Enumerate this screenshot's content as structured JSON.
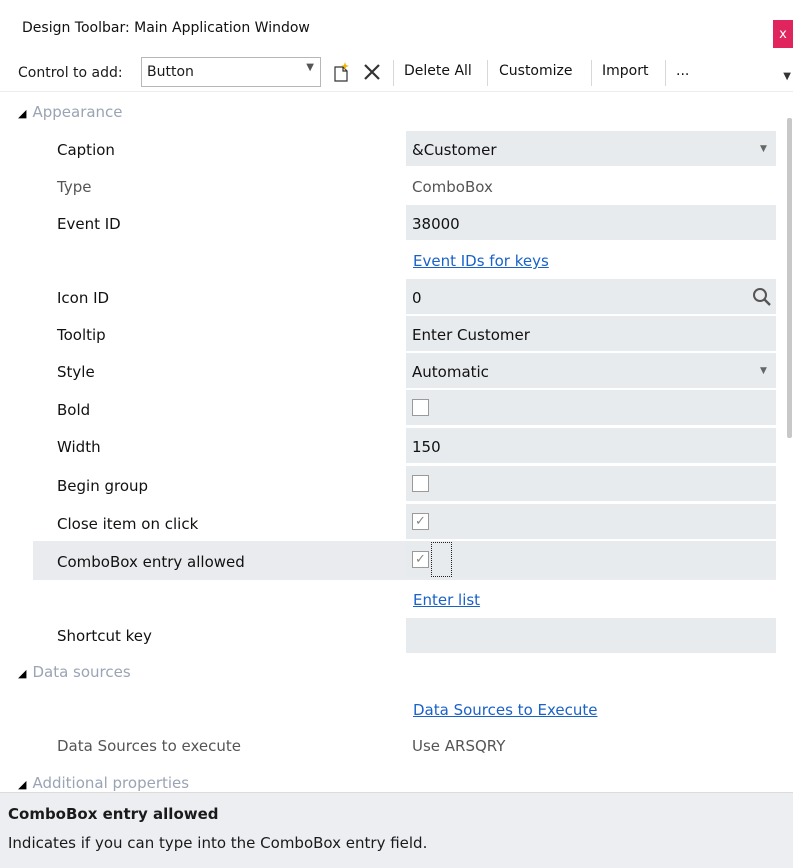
{
  "window": {
    "title": "Design Toolbar: Main Application Window",
    "close_label": "x"
  },
  "toolbar": {
    "control_label": "Control to add:",
    "control_value": "Button",
    "delete_all": "Delete All",
    "customize": "Customize",
    "import": "Import",
    "more": "..."
  },
  "sections": {
    "appearance": "Appearance",
    "data_sources": "Data sources",
    "additional": "Additional properties"
  },
  "properties": {
    "caption": {
      "label": "Caption",
      "value": "&Customer"
    },
    "type": {
      "label": "Type",
      "value": "ComboBox"
    },
    "event_id": {
      "label": "Event ID",
      "value": "38000"
    },
    "event_link": "Event IDs for keys",
    "icon_id": {
      "label": "Icon ID",
      "value": "0"
    },
    "tooltip": {
      "label": "Tooltip",
      "value": "Enter Customer"
    },
    "style": {
      "label": "Style",
      "value": "Automatic"
    },
    "bold": {
      "label": "Bold",
      "checked": false
    },
    "width": {
      "label": "Width",
      "value": "150"
    },
    "begin_group": {
      "label": "Begin group",
      "checked": false
    },
    "close_item": {
      "label": "Close item on click",
      "checked": true
    },
    "combo_entry": {
      "label": "ComboBox entry allowed",
      "checked": true
    },
    "enter_list": "Enter list",
    "shortcut": {
      "label": "Shortcut key",
      "value": ""
    },
    "ds_link": "Data Sources to Execute",
    "ds_execute": {
      "label": "Data Sources to execute",
      "value": "Use ARSQRY"
    }
  },
  "help": {
    "title": "ComboBox entry allowed",
    "text": "Indicates if you can type into the ComboBox entry field."
  },
  "glyphs": {
    "check": "✓",
    "dd": "▼",
    "tri": "◢"
  }
}
